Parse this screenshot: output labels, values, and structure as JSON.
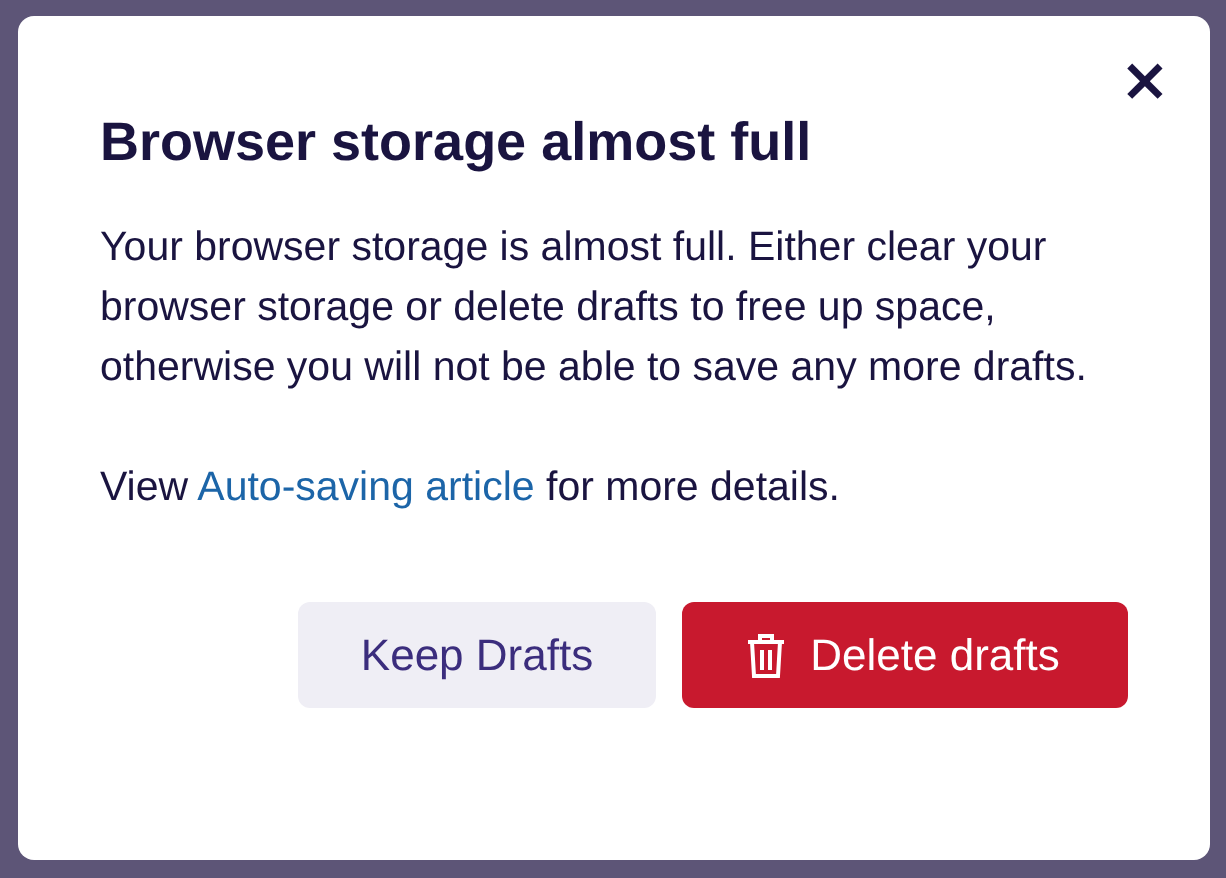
{
  "dialog": {
    "title": "Browser storage almost full",
    "close": "×",
    "message": "Your browser storage is almost full. Either clear your browser storage or delete drafts to free up space, otherwise you will not be able to save any more drafts.",
    "link_prefix": "View",
    "link": "Auto-saving article",
    "link_suffix": "for more details.",
    "buttons": [
      {
        "label": "Keep Drafts",
        "kind": "secondary"
      },
      {
        "label": "Delete drafts",
        "kind": "danger"
      }
    ]
  }
}
